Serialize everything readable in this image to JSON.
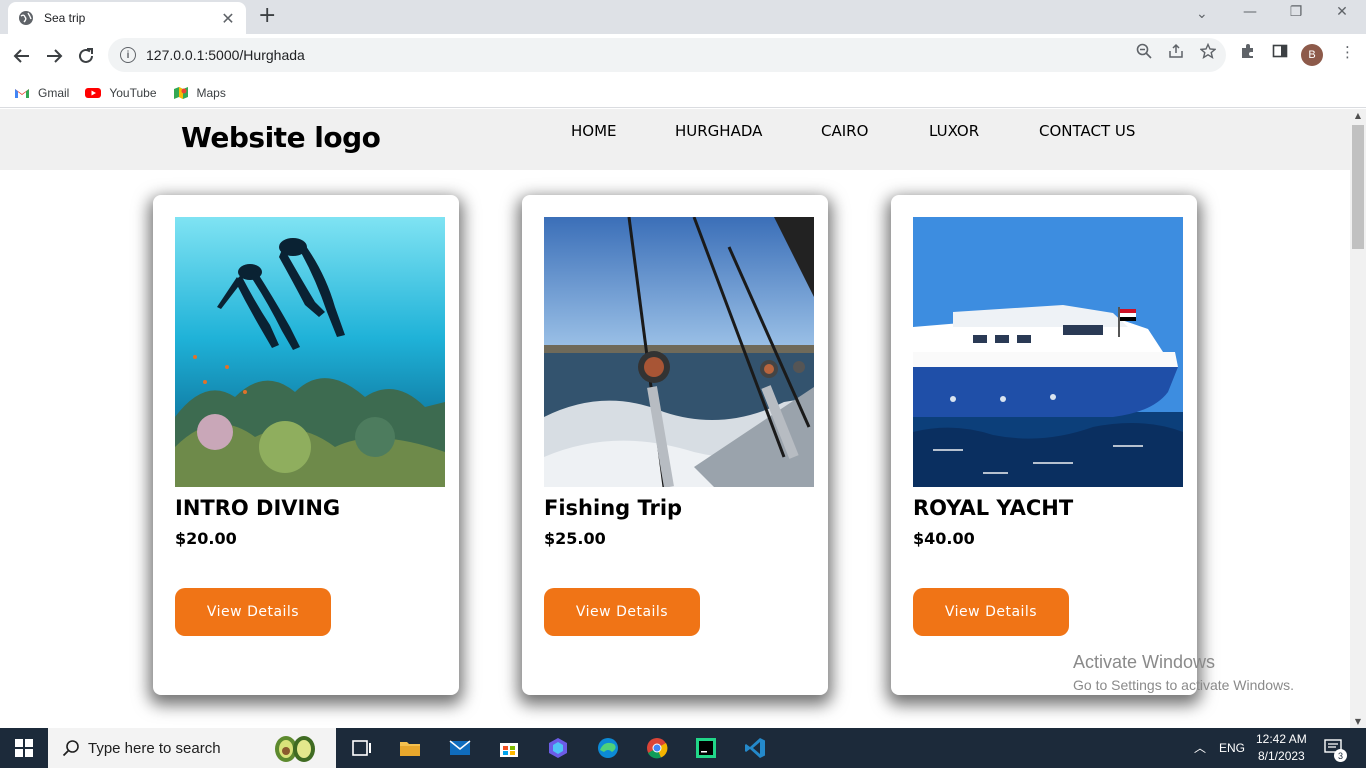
{
  "browser": {
    "tab_title": "Sea trip",
    "url": "127.0.0.1:5000/Hurghada",
    "bookmarks": [
      {
        "label": "Gmail",
        "icon": "gmail-icon"
      },
      {
        "label": "YouTube",
        "icon": "youtube-icon"
      },
      {
        "label": "Maps",
        "icon": "maps-icon"
      }
    ],
    "profile_initial": "B"
  },
  "site": {
    "logo": "Website logo",
    "nav": [
      "HOME",
      "HURGHADA",
      "CAIRO",
      "LUXOR",
      "CONTACT US"
    ]
  },
  "cards": [
    {
      "title": "INTRO DIVING",
      "price": "$20.00",
      "button": "View Details",
      "image": "diving-photo"
    },
    {
      "title": "Fishing Trip",
      "price": "$25.00",
      "button": "View Details",
      "image": "fishing-photo"
    },
    {
      "title": "ROYAL YACHT",
      "price": "$40.00",
      "button": "View Details",
      "image": "yacht-photo"
    }
  ],
  "watermark": {
    "line1": "Activate Windows",
    "line2": "Go to Settings to activate Windows."
  },
  "taskbar": {
    "search_placeholder": "Type here to search",
    "language": "ENG",
    "time": "12:42 AM",
    "date": "8/1/2023",
    "notifications": "3"
  },
  "colors": {
    "accent": "#f07416",
    "header_bg": "#f0f0f0"
  }
}
